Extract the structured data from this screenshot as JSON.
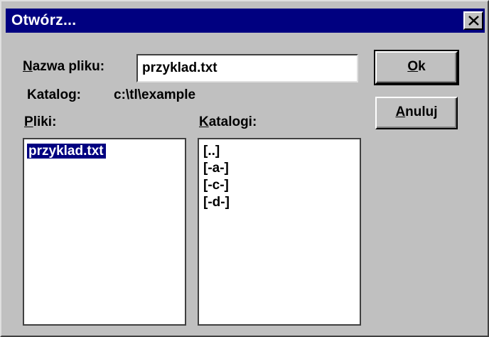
{
  "dialog": {
    "title": "Otwórz...",
    "colors": {
      "face": "#c0c0c0",
      "titlebar": "#000080",
      "title_text": "#ffffff",
      "selection": "#000080"
    }
  },
  "filename": {
    "label_mnemonic": "N",
    "label_rest": "azwa pliku:",
    "value": "przyklad.txt"
  },
  "directory": {
    "label": "Katalog:",
    "path": "c:\\tl\\example"
  },
  "files": {
    "label_mnemonic": "P",
    "label_rest": "liki:",
    "items": [
      "przyklad.txt"
    ],
    "selected": "przyklad.txt"
  },
  "folders": {
    "label_mnemonic": "K",
    "label_rest": "atalogi:",
    "items": [
      "[..]",
      "[-a-]",
      "[-c-]",
      "[-d-]"
    ]
  },
  "buttons": {
    "ok_mnemonic": "O",
    "ok_rest": "k",
    "cancel_mnemonic": "A",
    "cancel_rest": "nuluj"
  },
  "icons": {
    "close": "close-icon"
  }
}
